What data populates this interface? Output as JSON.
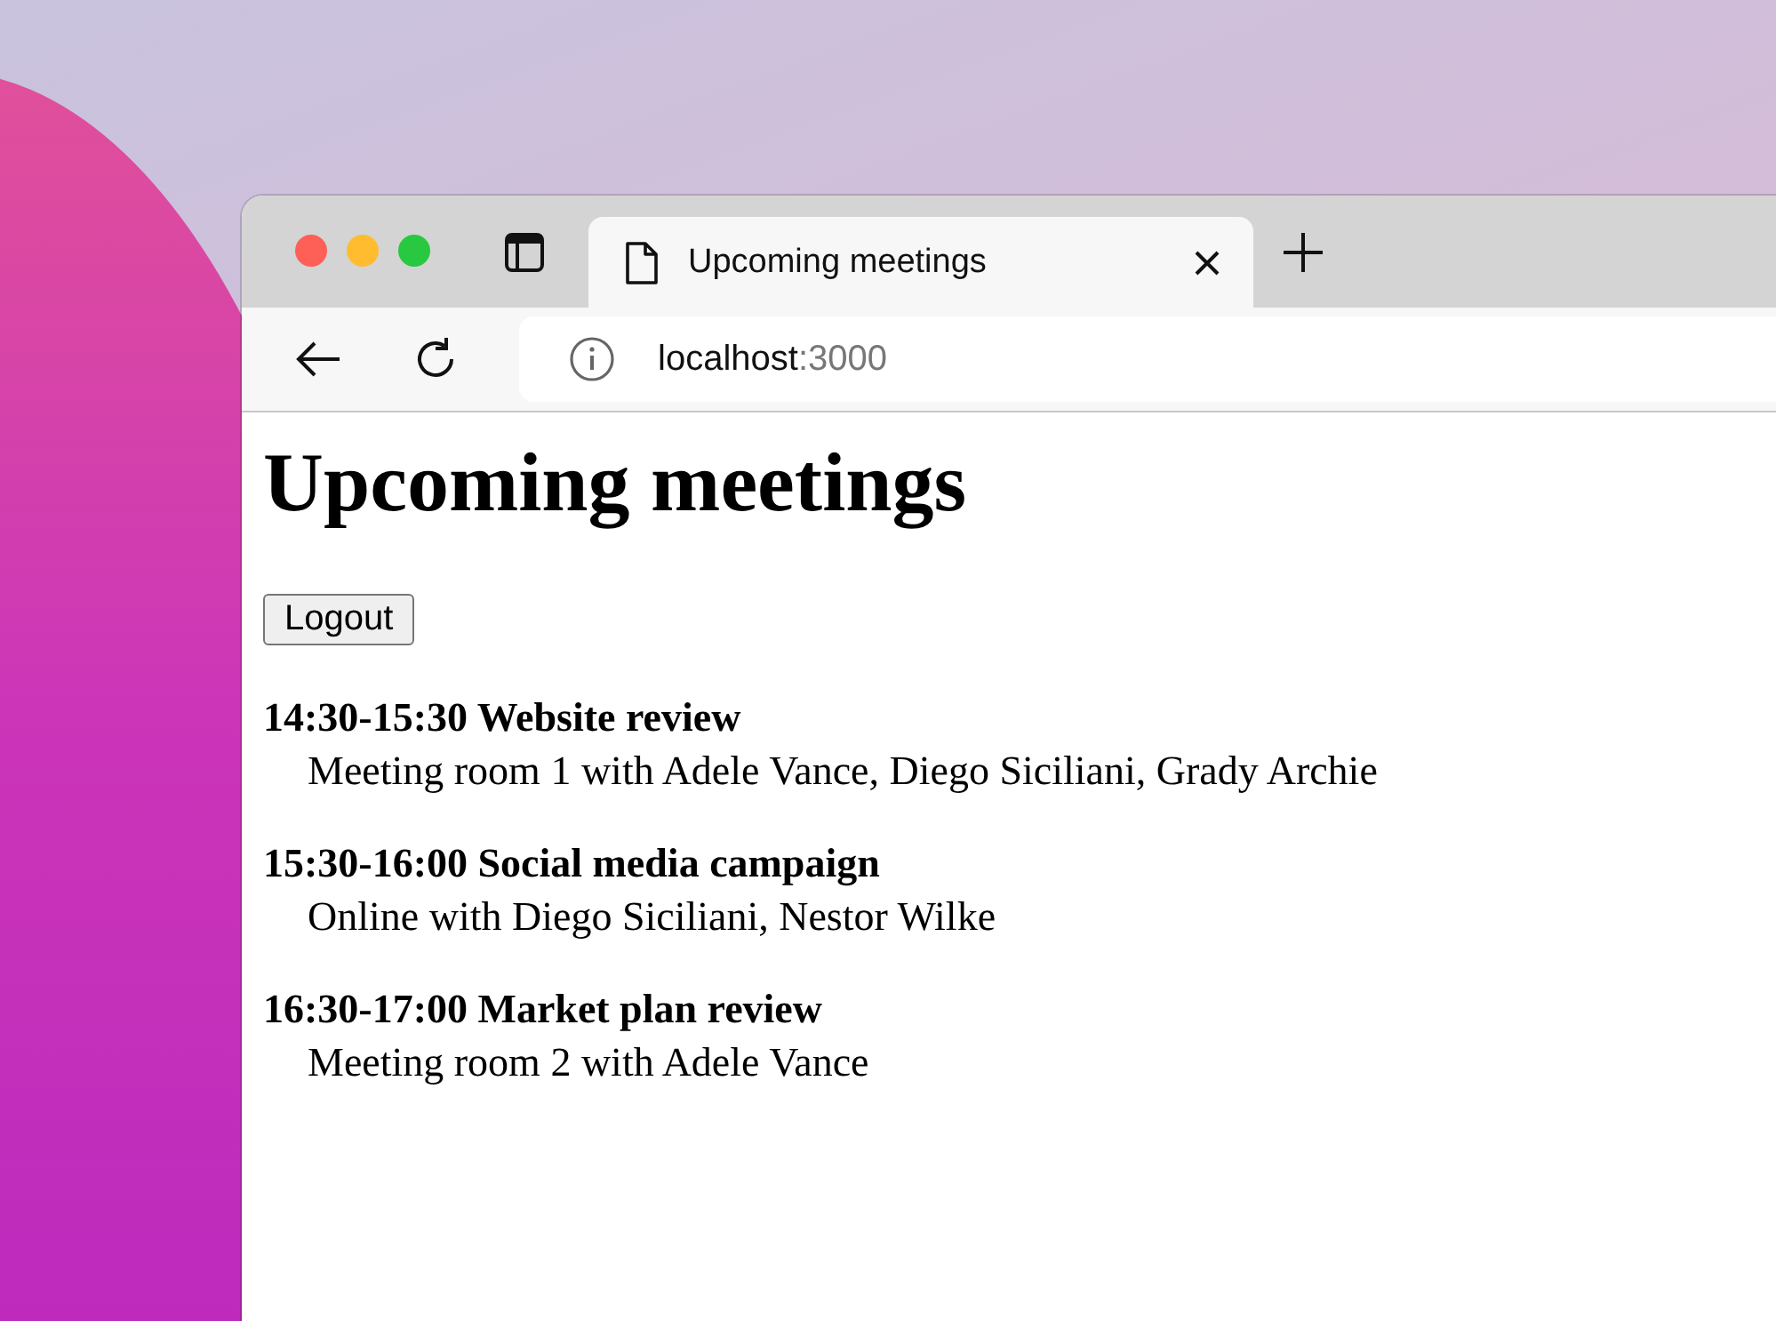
{
  "tab": {
    "title": "Upcoming meetings",
    "selected": true
  },
  "address_bar": {
    "host": "localhost",
    "port": ":3000"
  },
  "page": {
    "heading": "Upcoming meetings",
    "button": "Logout",
    "meetings": [
      {
        "time": "14:30-15:30",
        "subject": "Website review",
        "details": "Meeting room 1 with Adele Vance, Diego Siciliani, Grady Archie"
      },
      {
        "time": "15:30-16:00",
        "subject": "Social media campaign",
        "details": "Online with Diego Siciliani, Nestor Wilke"
      },
      {
        "time": "16:30-17:00",
        "subject": "Market plan review",
        "details": "Meeting room 2 with Adele Vance"
      }
    ]
  }
}
